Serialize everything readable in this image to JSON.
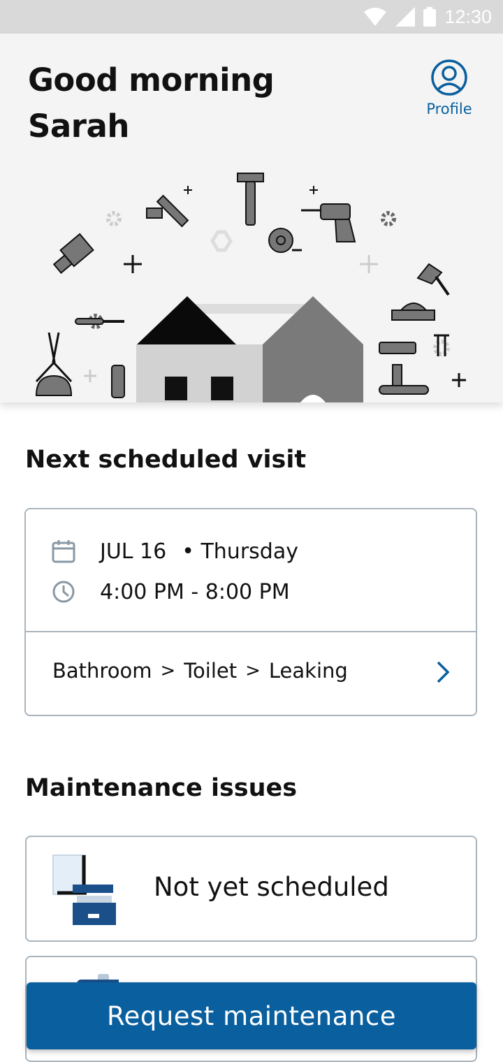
{
  "status_bar": {
    "time": "12:30"
  },
  "header": {
    "greeting_line1": "Good morning",
    "greeting_line2": "Sarah",
    "profile_label": "Profile"
  },
  "next_visit": {
    "section_title": "Next scheduled visit",
    "date": "JUL 16",
    "day": "• Thursday",
    "time_range": "4:00 PM - 8:00 PM",
    "breadcrumb": [
      "Bathroom",
      "Toilet",
      "Leaking"
    ]
  },
  "maintenance": {
    "section_title": "Maintenance issues",
    "items": [
      {
        "label": "Not yet scheduled",
        "icon": "file-cabinet-icon"
      },
      {
        "label": "",
        "icon": "clipboard-icon"
      }
    ]
  },
  "actions": {
    "request_label": "Request maintenance"
  },
  "colors": {
    "accent": "#0a5f9e",
    "header_bg": "#f4f4f4",
    "status_bar": "#d9d9d9"
  }
}
